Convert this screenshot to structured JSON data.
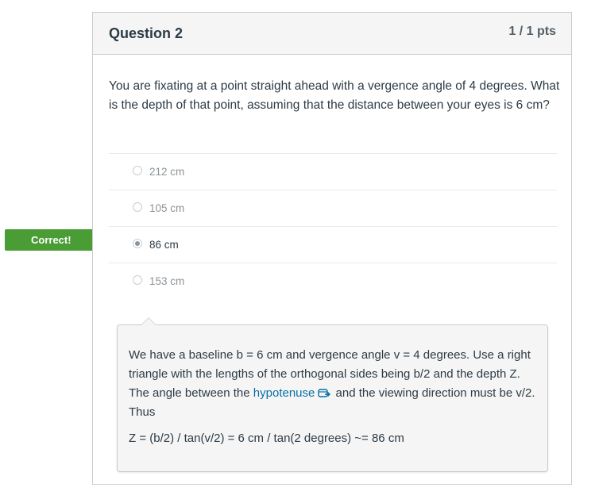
{
  "question": {
    "title": "Question 2",
    "points": "1 / 1 pts",
    "text": "You are fixating at a point straight ahead with a vergence angle of 4 degrees. What is the depth of that point, assuming that the distance between your eyes is 6 cm?"
  },
  "answers": [
    {
      "label": "212 cm",
      "selected": false
    },
    {
      "label": "105 cm",
      "selected": false
    },
    {
      "label": "86 cm",
      "selected": true
    },
    {
      "label": "153 cm",
      "selected": false
    }
  ],
  "result_tag": "Correct!",
  "comment": {
    "part1": "We have a baseline b = 6 cm and vergence angle v = 4 degrees. Use a right triangle with the lengths of the orthogonal sides being b/2 and the depth Z. The angle between the ",
    "link_text": "hypotenuse",
    "link_icon": "external-link-icon",
    "part2": " and the viewing direction must be v/2. Thus",
    "formula": "Z = (b/2) / tan(v/2) = 6 cm / tan(2 degrees) ~= 86 cm"
  },
  "colors": {
    "correct_green": "#4a9c34",
    "link_blue": "#0770a3",
    "header_bg": "#f5f5f5",
    "border": "#c7cdd1"
  }
}
